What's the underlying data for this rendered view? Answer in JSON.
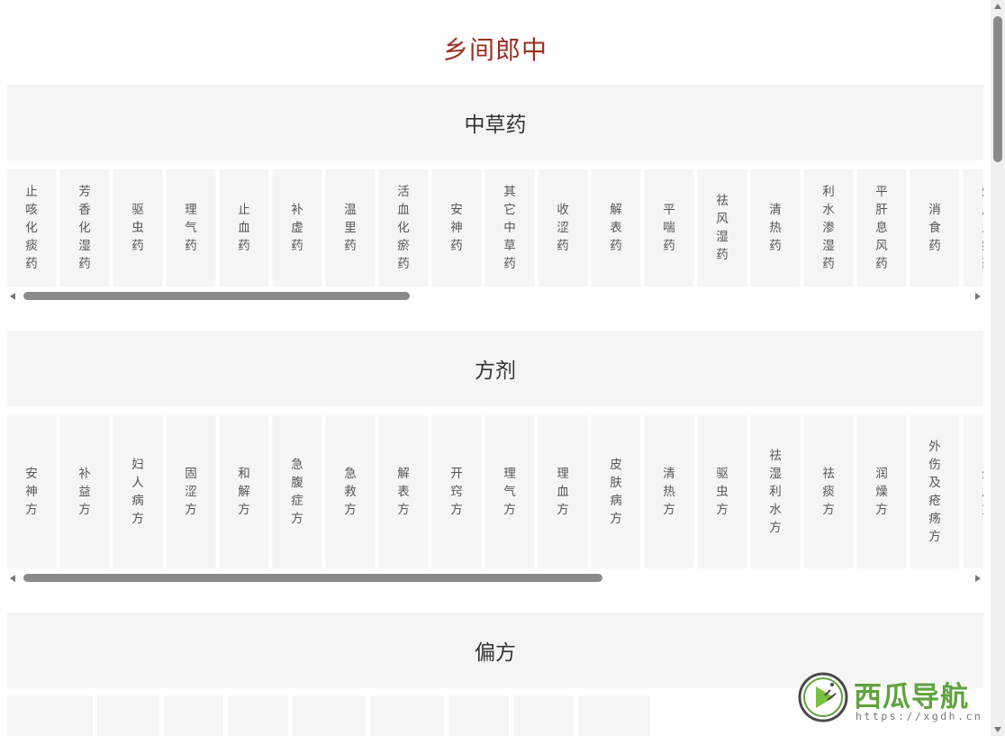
{
  "title": "乡间郎中",
  "sections": [
    {
      "heading": "中草药",
      "items": [
        "止咳化痰药",
        "芳香化湿药",
        "驱虫药",
        "理气药",
        "止血药",
        "补虚药",
        "温里药",
        "活血化瘀药",
        "安神药",
        "其它中草药",
        "收涩药",
        "解表药",
        "平喘药",
        "祛风湿药",
        "清热药",
        "利水渗湿药",
        "平肝息风药",
        "消食药",
        "熄风止痉药"
      ]
    },
    {
      "heading": "方剂",
      "items": [
        "安神方",
        "补益方",
        "妇人病方",
        "固涩方",
        "和解方",
        "急腹症方",
        "急救方",
        "解表方",
        "开窍方",
        "理气方",
        "理血方",
        "皮肤病方",
        "清热方",
        "驱虫方",
        "祛湿利水方",
        "祛痰方",
        "润燥方",
        "外伤及疮疡方",
        "外用方"
      ]
    },
    {
      "heading": "偏方",
      "items": []
    }
  ],
  "watermark": {
    "brand": "西瓜导航",
    "url": "https://xgdh.cn"
  },
  "colors": {
    "title": "#9b2f22",
    "tile_bg": "#f5f5f5",
    "brand": "#5fa33d"
  }
}
